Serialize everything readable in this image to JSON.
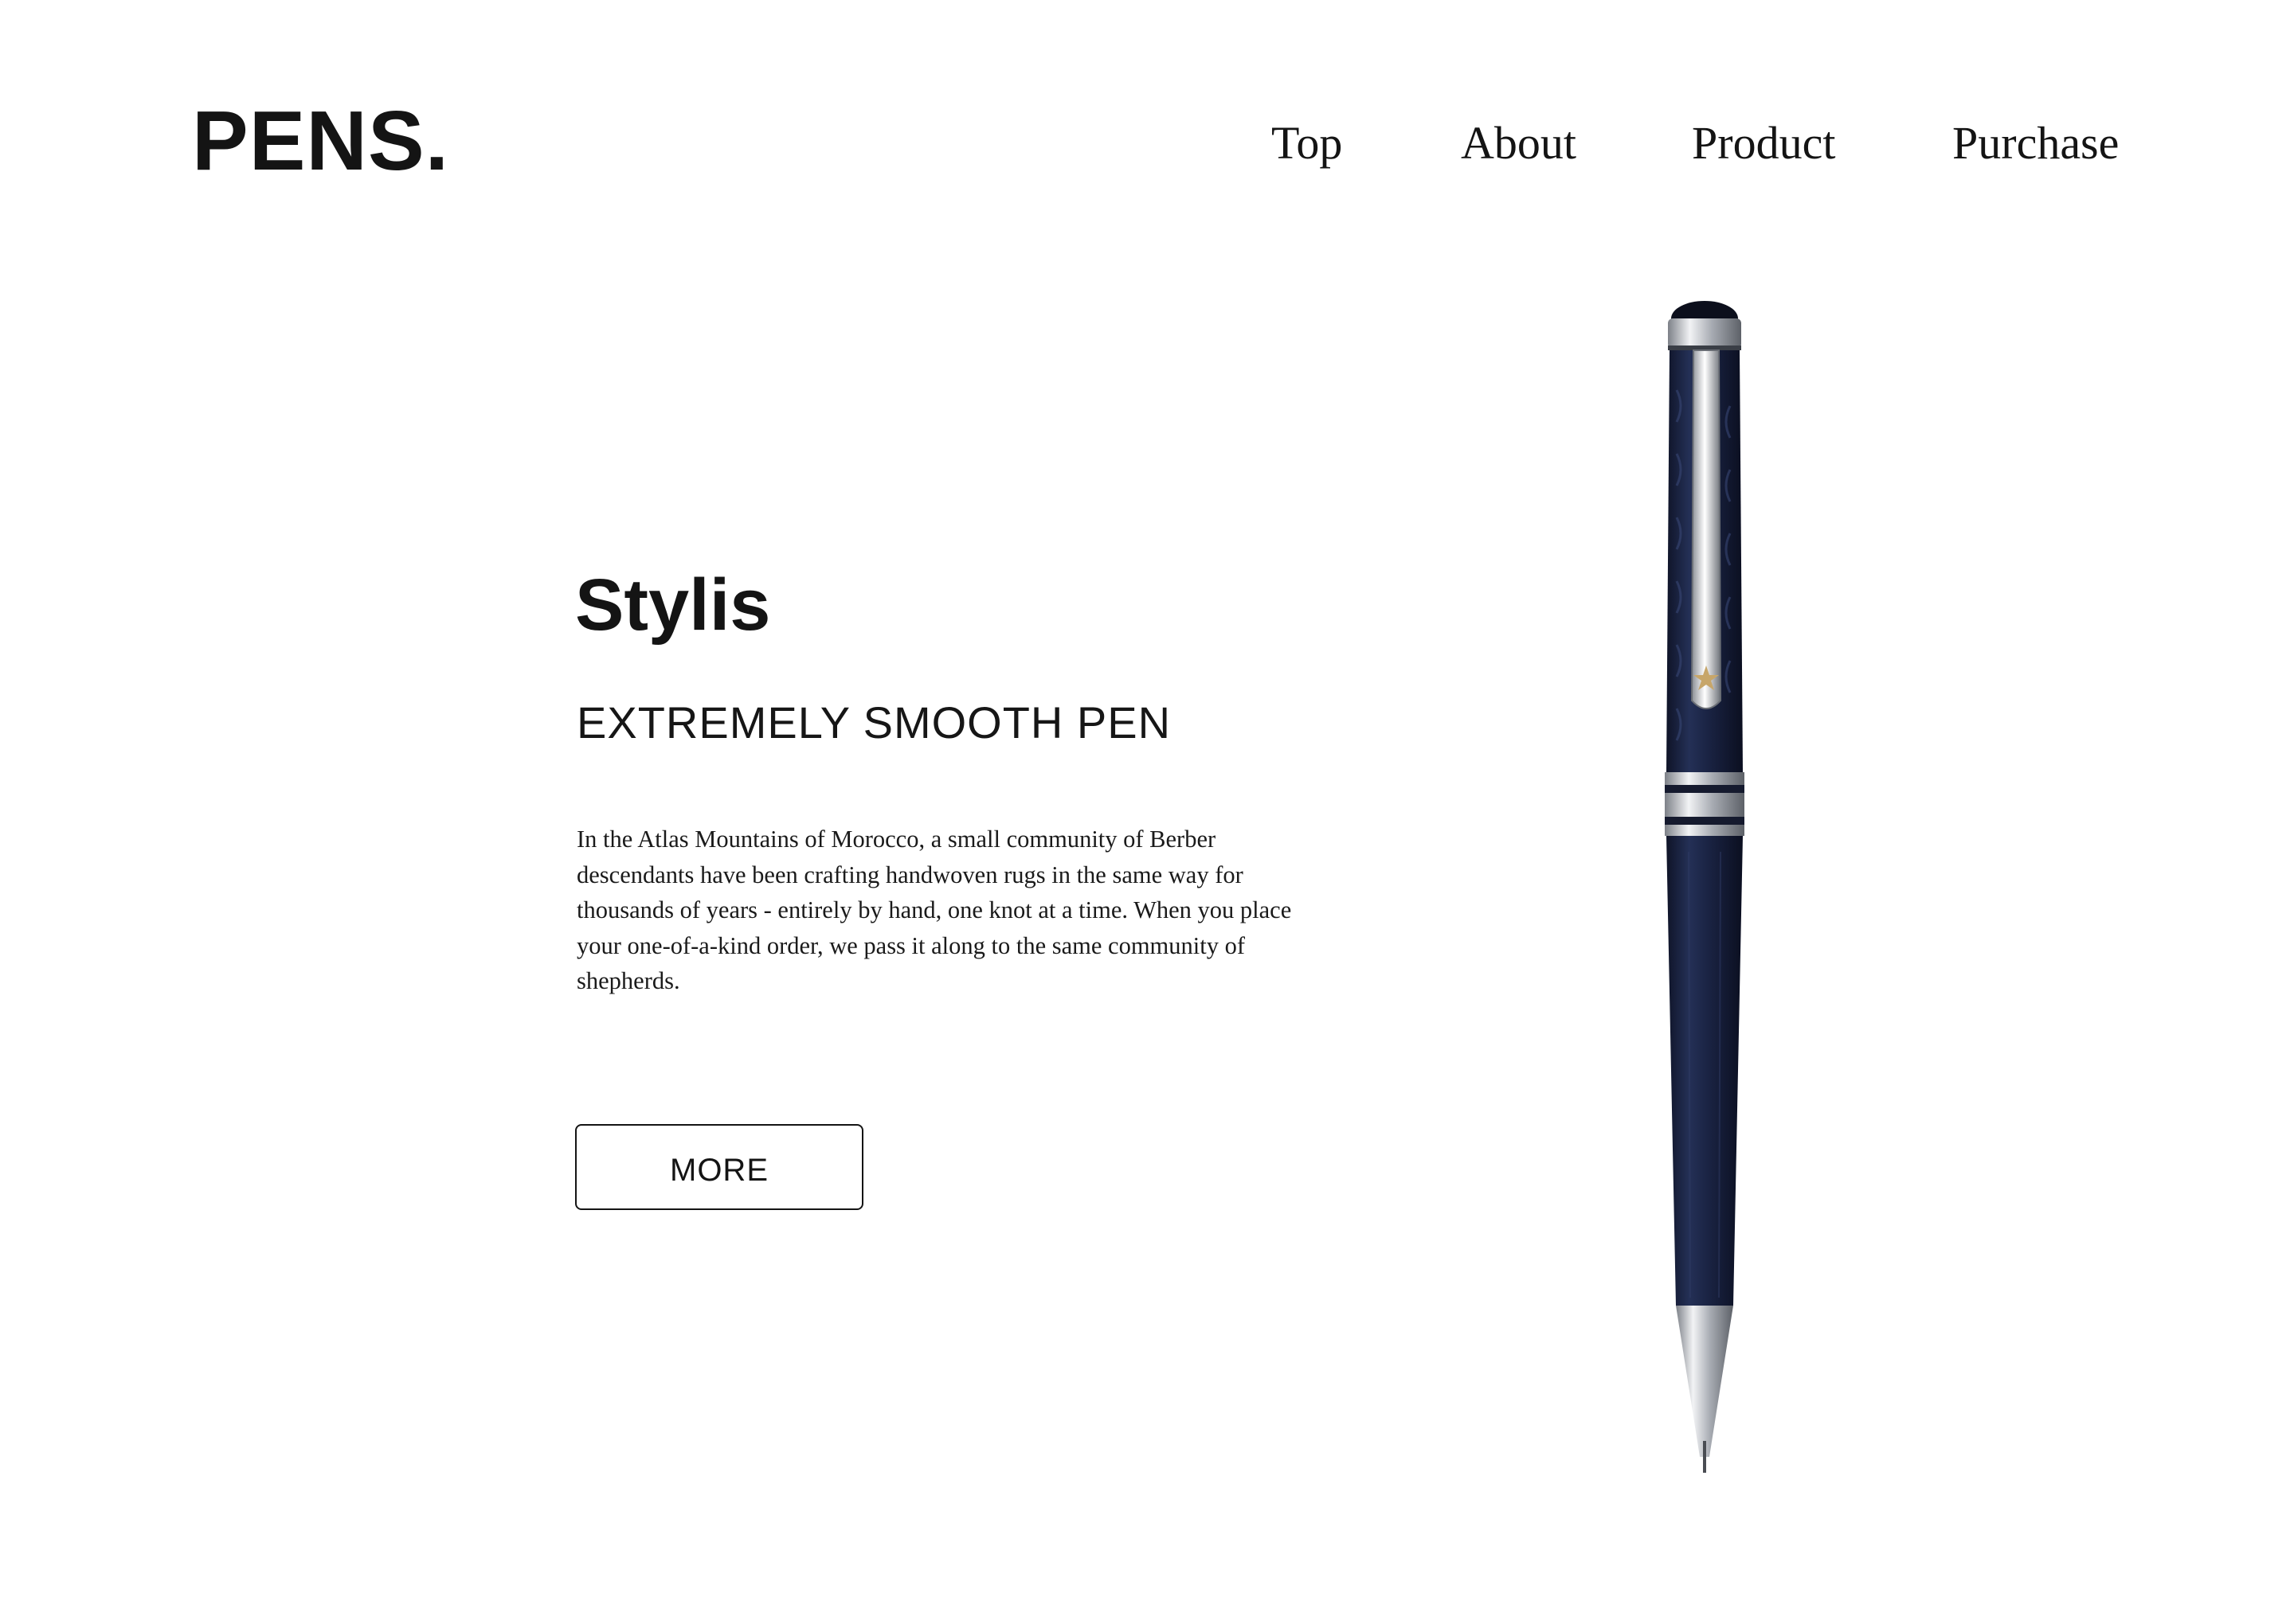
{
  "header": {
    "logo": "PENS.",
    "nav": [
      {
        "label": "Top"
      },
      {
        "label": "About"
      },
      {
        "label": "Product"
      },
      {
        "label": "Purchase"
      }
    ]
  },
  "hero": {
    "title": "Stylis",
    "subtitle": "EXTREMELY SMOOTH PEN",
    "description": "In the Atlas Mountains of Morocco, a small community of Berber descendants have been crafting handwoven rugs in the same way for thousands of years - entirely by hand, one knot at a time. When you place your one-of-a-kind order, we pass it along to the same community of shepherds.",
    "more_label": "MORE"
  },
  "colors": {
    "text": "#141414",
    "pen_body": "#1c2440",
    "pen_metal": "#c9ccd1",
    "background": "#ffffff"
  },
  "images": {
    "product": "pen-image"
  }
}
